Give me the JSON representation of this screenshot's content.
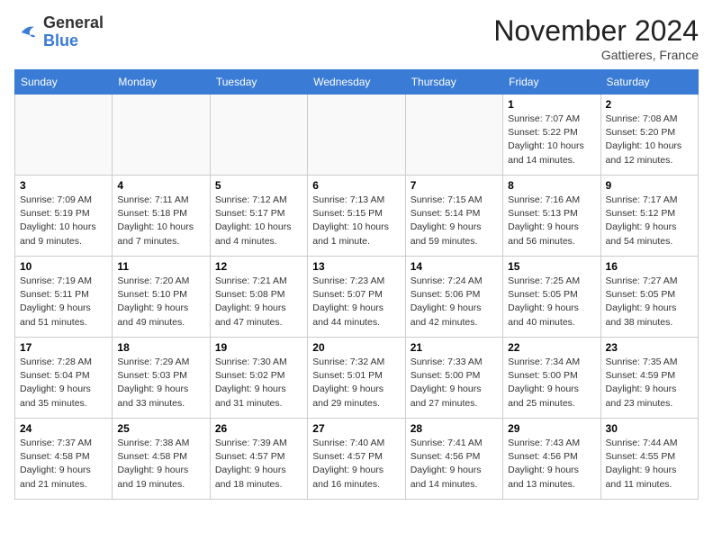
{
  "header": {
    "logo_general": "General",
    "logo_blue": "Blue",
    "month_title": "November 2024",
    "location": "Gattieres, France"
  },
  "columns": [
    "Sunday",
    "Monday",
    "Tuesday",
    "Wednesday",
    "Thursday",
    "Friday",
    "Saturday"
  ],
  "weeks": [
    [
      {
        "day": "",
        "detail": ""
      },
      {
        "day": "",
        "detail": ""
      },
      {
        "day": "",
        "detail": ""
      },
      {
        "day": "",
        "detail": ""
      },
      {
        "day": "",
        "detail": ""
      },
      {
        "day": "1",
        "detail": "Sunrise: 7:07 AM\nSunset: 5:22 PM\nDaylight: 10 hours and 14 minutes."
      },
      {
        "day": "2",
        "detail": "Sunrise: 7:08 AM\nSunset: 5:20 PM\nDaylight: 10 hours and 12 minutes."
      }
    ],
    [
      {
        "day": "3",
        "detail": "Sunrise: 7:09 AM\nSunset: 5:19 PM\nDaylight: 10 hours and 9 minutes."
      },
      {
        "day": "4",
        "detail": "Sunrise: 7:11 AM\nSunset: 5:18 PM\nDaylight: 10 hours and 7 minutes."
      },
      {
        "day": "5",
        "detail": "Sunrise: 7:12 AM\nSunset: 5:17 PM\nDaylight: 10 hours and 4 minutes."
      },
      {
        "day": "6",
        "detail": "Sunrise: 7:13 AM\nSunset: 5:15 PM\nDaylight: 10 hours and 1 minute."
      },
      {
        "day": "7",
        "detail": "Sunrise: 7:15 AM\nSunset: 5:14 PM\nDaylight: 9 hours and 59 minutes."
      },
      {
        "day": "8",
        "detail": "Sunrise: 7:16 AM\nSunset: 5:13 PM\nDaylight: 9 hours and 56 minutes."
      },
      {
        "day": "9",
        "detail": "Sunrise: 7:17 AM\nSunset: 5:12 PM\nDaylight: 9 hours and 54 minutes."
      }
    ],
    [
      {
        "day": "10",
        "detail": "Sunrise: 7:19 AM\nSunset: 5:11 PM\nDaylight: 9 hours and 51 minutes."
      },
      {
        "day": "11",
        "detail": "Sunrise: 7:20 AM\nSunset: 5:10 PM\nDaylight: 9 hours and 49 minutes."
      },
      {
        "day": "12",
        "detail": "Sunrise: 7:21 AM\nSunset: 5:08 PM\nDaylight: 9 hours and 47 minutes."
      },
      {
        "day": "13",
        "detail": "Sunrise: 7:23 AM\nSunset: 5:07 PM\nDaylight: 9 hours and 44 minutes."
      },
      {
        "day": "14",
        "detail": "Sunrise: 7:24 AM\nSunset: 5:06 PM\nDaylight: 9 hours and 42 minutes."
      },
      {
        "day": "15",
        "detail": "Sunrise: 7:25 AM\nSunset: 5:05 PM\nDaylight: 9 hours and 40 minutes."
      },
      {
        "day": "16",
        "detail": "Sunrise: 7:27 AM\nSunset: 5:05 PM\nDaylight: 9 hours and 38 minutes."
      }
    ],
    [
      {
        "day": "17",
        "detail": "Sunrise: 7:28 AM\nSunset: 5:04 PM\nDaylight: 9 hours and 35 minutes."
      },
      {
        "day": "18",
        "detail": "Sunrise: 7:29 AM\nSunset: 5:03 PM\nDaylight: 9 hours and 33 minutes."
      },
      {
        "day": "19",
        "detail": "Sunrise: 7:30 AM\nSunset: 5:02 PM\nDaylight: 9 hours and 31 minutes."
      },
      {
        "day": "20",
        "detail": "Sunrise: 7:32 AM\nSunset: 5:01 PM\nDaylight: 9 hours and 29 minutes."
      },
      {
        "day": "21",
        "detail": "Sunrise: 7:33 AM\nSunset: 5:00 PM\nDaylight: 9 hours and 27 minutes."
      },
      {
        "day": "22",
        "detail": "Sunrise: 7:34 AM\nSunset: 5:00 PM\nDaylight: 9 hours and 25 minutes."
      },
      {
        "day": "23",
        "detail": "Sunrise: 7:35 AM\nSunset: 4:59 PM\nDaylight: 9 hours and 23 minutes."
      }
    ],
    [
      {
        "day": "24",
        "detail": "Sunrise: 7:37 AM\nSunset: 4:58 PM\nDaylight: 9 hours and 21 minutes."
      },
      {
        "day": "25",
        "detail": "Sunrise: 7:38 AM\nSunset: 4:58 PM\nDaylight: 9 hours and 19 minutes."
      },
      {
        "day": "26",
        "detail": "Sunrise: 7:39 AM\nSunset: 4:57 PM\nDaylight: 9 hours and 18 minutes."
      },
      {
        "day": "27",
        "detail": "Sunrise: 7:40 AM\nSunset: 4:57 PM\nDaylight: 9 hours and 16 minutes."
      },
      {
        "day": "28",
        "detail": "Sunrise: 7:41 AM\nSunset: 4:56 PM\nDaylight: 9 hours and 14 minutes."
      },
      {
        "day": "29",
        "detail": "Sunrise: 7:43 AM\nSunset: 4:56 PM\nDaylight: 9 hours and 13 minutes."
      },
      {
        "day": "30",
        "detail": "Sunrise: 7:44 AM\nSunset: 4:55 PM\nDaylight: 9 hours and 11 minutes."
      }
    ]
  ]
}
